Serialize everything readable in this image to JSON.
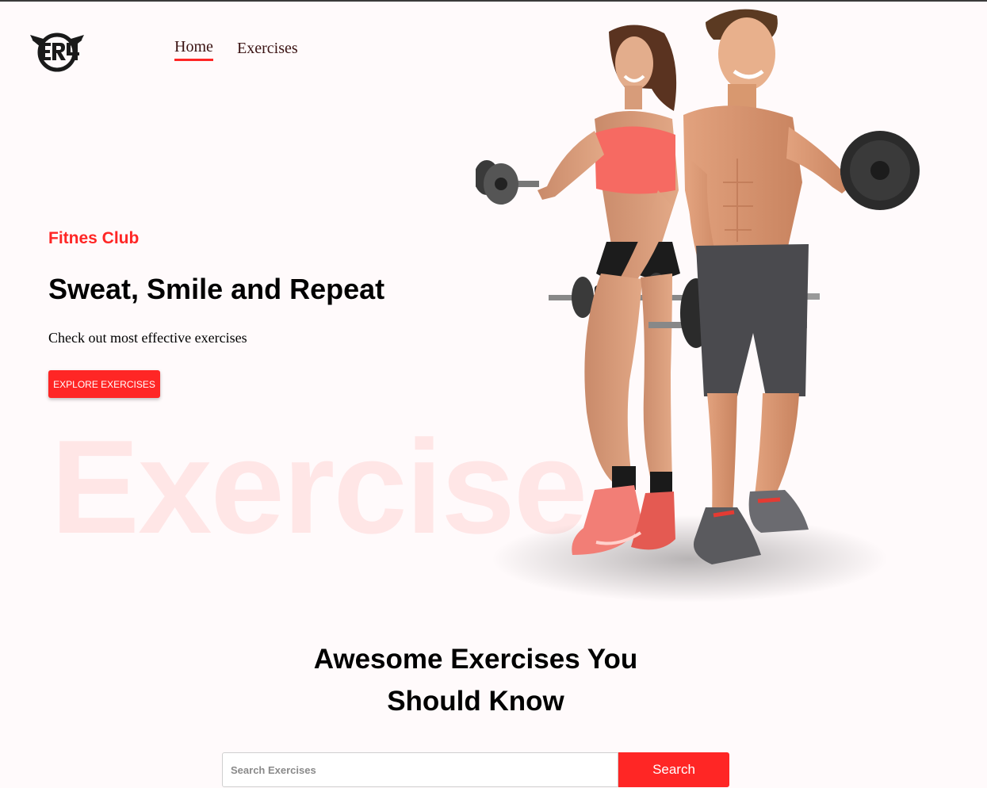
{
  "nav": {
    "links": [
      {
        "label": "Home",
        "active": true
      },
      {
        "label": "Exercises",
        "active": false
      }
    ]
  },
  "hero": {
    "subtitle": "Fitnes Club",
    "title": "Sweat, Smile and Repeat",
    "description": "Check out most effective exercises",
    "button_label": "EXPLORE EXERCISES",
    "watermark": "Exercise"
  },
  "search": {
    "title_line1": "Awesome Exercises You",
    "title_line2": "Should Know",
    "placeholder": "Search Exercises",
    "button_label": "Search"
  },
  "colors": {
    "accent": "#ff2625",
    "background": "#fffafb"
  },
  "icons": {
    "logo": "winged-circle-logo"
  }
}
